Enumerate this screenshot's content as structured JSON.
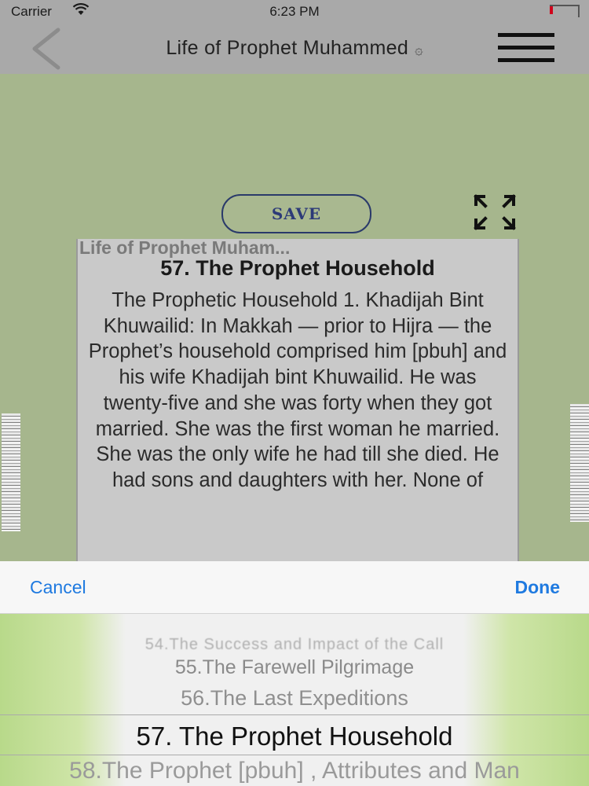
{
  "status_bar": {
    "carrier": "Carrier",
    "time": "6:23 PM"
  },
  "nav": {
    "title": "Life of Prophet Muhammed",
    "ornament": "۞",
    "back_icon": "chevron-left-icon",
    "menu_icon": "hamburger-icon"
  },
  "toolbar": {
    "save_label": "SAVE",
    "expand_icon": "expand-arrows-icon"
  },
  "page": {
    "header": "Life of Prophet Muham...",
    "chapter_title": "57. The Prophet Household",
    "body": "The Prophetic Household 1. Khadijah Bint Khuwailid: In Makkah — prior to Hijra — the Prophet’s household comprised him [pbuh] and his wife Khadijah bint Khuwailid. He was twenty-five and she was forty when they got married. She was the first woman he married. She was the only wife he had till she died. He had sons and daughters with her. None of"
  },
  "sheet": {
    "cancel_label": "Cancel",
    "done_label": "Done",
    "options": [
      "54.The Success and Impact of the Call",
      "55.The Farewell Pilgrimage",
      "56.The Last Expeditions",
      "57. The Prophet Household",
      "58.The Prophet [pbuh] , Attributes and Man"
    ],
    "selected": "57. The Prophet Household"
  },
  "colors": {
    "accent": "#1f7ae0",
    "content_bg": "#a6b68d",
    "bar_bg": "#a9a9a9"
  }
}
